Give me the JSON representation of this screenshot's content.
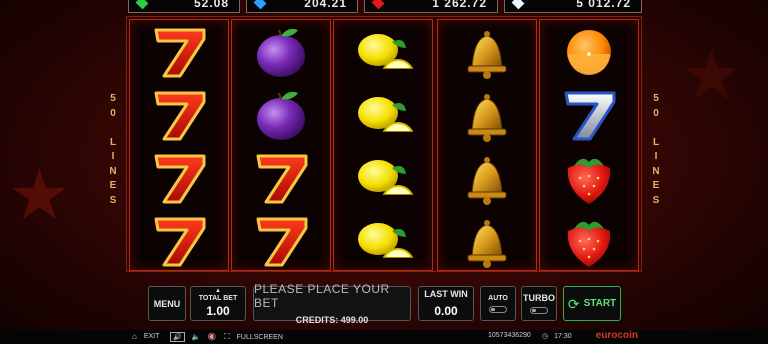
{
  "jackpots": [
    {
      "gem": "emerald-icon",
      "color": "#2ecc40",
      "value": "52.08"
    },
    {
      "gem": "sapphire-icon",
      "color": "#2aa0ff",
      "value": "204.21"
    },
    {
      "gem": "ruby-icon",
      "color": "#e01a1a",
      "value": "1 262.72"
    },
    {
      "gem": "diamond-icon",
      "color": "#e8f4ff",
      "value": "5 012.72"
    }
  ],
  "lines_label_left": [
    "5",
    "0",
    "",
    "L",
    "I",
    "N",
    "E",
    "S"
  ],
  "lines_label_right": [
    "5",
    "0",
    "",
    "L",
    "I",
    "N",
    "E",
    "S"
  ],
  "reels": [
    [
      "seven",
      "seven",
      "seven",
      "seven"
    ],
    [
      "plum",
      "plum",
      "seven",
      "seven"
    ],
    [
      "lemon",
      "lemon",
      "lemon",
      "lemon"
    ],
    [
      "bell",
      "bell",
      "bell",
      "bell"
    ],
    [
      "orange",
      "silver-seven",
      "strawberry",
      "strawberry"
    ]
  ],
  "controls": {
    "menu_label": "MENU",
    "total_bet_label": "TOTAL BET",
    "total_bet_value": "1.00",
    "message": "PLEASE PLACE YOUR BET",
    "credits_text": "CREDITS: 499.00",
    "last_win_label": "LAST WIN",
    "last_win_value": "0.00",
    "auto_label": "AUTO",
    "turbo_label": "TURBO",
    "start_label": "START"
  },
  "statusbar": {
    "exit_label": "EXIT",
    "fullscreen_label": "FULLSCREEN",
    "session_id": "10573436290",
    "time": "17:30",
    "brand": "eurocoin"
  },
  "colors": {
    "accent_gold": "#d8b66a",
    "reel_border": "#b42a12",
    "start_green": "#2fb24a"
  }
}
